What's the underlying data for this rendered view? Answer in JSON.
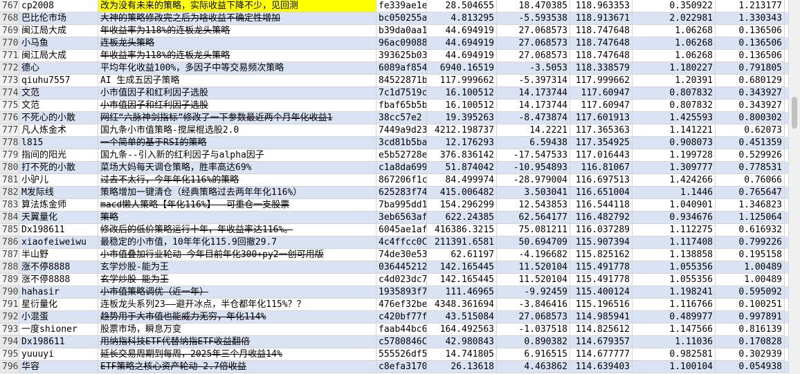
{
  "rows": [
    {
      "n": "767",
      "user": "cp2008",
      "name": "改为没有未来的策略，实际收益下降不少，见回测",
      "id": "fe339ae1e",
      "a": "28.504655",
      "b": "18.470385",
      "c": "118.963353",
      "d": "0.350922",
      "e": "1.213177",
      "strike": false,
      "hl": true
    },
    {
      "n": "768",
      "user": "巴比伦市场",
      "name": "大神的策略修改完之后为啥收益不确定性增加",
      "id": "bc050255a",
      "a": "4.813295",
      "b": "-5.593538",
      "c": "118.913671",
      "d": "2.022981",
      "e": "1.330343",
      "strike": true,
      "hl": false
    },
    {
      "n": "769",
      "user": "闽江局大成",
      "name": "年收益率为118%的连板龙头策略",
      "id": "b39da0aa1",
      "a": "44.694919",
      "b": "27.068573",
      "c": "118.747648",
      "d": "1.06268",
      "e": "0.136506",
      "strike": true,
      "hl": false
    },
    {
      "n": "770",
      "user": "小马鱼",
      "name": "连板龙头策略",
      "id": "96ac09088",
      "a": "44.694919",
      "b": "27.068573",
      "c": "118.747648",
      "d": "1.06268",
      "e": "0.136506",
      "strike": true,
      "hl": false
    },
    {
      "n": "771",
      "user": "闽江局大成",
      "name": "年收益率为118%的连板龙头策略",
      "id": "393625b03",
      "a": "44.694919",
      "b": "27.068573",
      "c": "118.747648",
      "d": "1.06268",
      "e": "0.136506",
      "strike": true,
      "hl": false
    },
    {
      "n": "772",
      "user": "德心",
      "name": "平均年化收益100%，多因子中等交易频次策略",
      "id": "6089af854",
      "a": "6940.16519",
      "b": "-3.5053",
      "c": "118.338579",
      "d": "1.180227",
      "e": "0.791805",
      "strike": false,
      "hl": false
    },
    {
      "n": "773",
      "user": "qiuhu7557",
      "name": "AI 生成五因子策略",
      "id": "84522871b",
      "a": "117.999662",
      "b": "-5.397314",
      "c": "117.999662",
      "d": "1.20391",
      "e": "0.680129",
      "strike": false,
      "hl": false
    },
    {
      "n": "774",
      "user": "文范",
      "name": "小市值因子和红利因子选股",
      "id": "7c1d7519c",
      "a": "16.100512",
      "b": "14.173744",
      "c": "117.60947",
      "d": "0.807832",
      "e": "0.343927",
      "strike": false,
      "hl": false
    },
    {
      "n": "775",
      "user": "文范",
      "name": "小市值因子和红利因子选股",
      "id": "fbaf65b5b",
      "a": "16.100512",
      "b": "14.173744",
      "c": "117.60947",
      "d": "0.807832",
      "e": "0.343927",
      "strike": true,
      "hl": false
    },
    {
      "n": "776",
      "user": "不死心的小散",
      "name": "网红“六脉神剑指标”修改了一下参数最近两个月年化收益1",
      "id": "38cc57e2",
      "a": "19.395263",
      "b": "-8.473874",
      "c": "117.601913",
      "d": "1.425593",
      "e": "0.800302",
      "strike": true,
      "hl": false
    },
    {
      "n": "777",
      "user": "凡人炼金术",
      "name": "国九条小市值策略-搅屎棍选股2.0",
      "id": "7449a9d23",
      "a": "4212.198737",
      "b": "14.2221",
      "c": "117.365363",
      "d": "1.141221",
      "e": "0.62073",
      "strike": false,
      "hl": false
    },
    {
      "n": "778",
      "user": "l815",
      "name": "一个简单的基于RSI的策略",
      "id": "3cd81b5ba",
      "a": "12.176293",
      "b": "6.59438",
      "c": "117.354925",
      "d": "0.908073",
      "e": "0.451359",
      "strike": true,
      "hl": false
    },
    {
      "n": "779",
      "user": "指间的阳光",
      "name": "国九条--引入新的红利因子与alpha因子",
      "id": "e5b52728e",
      "a": "376.836142",
      "b": "-17.547533",
      "c": "117.016443",
      "d": "1.199728",
      "e": "0.529926",
      "strike": false,
      "hl": false
    },
    {
      "n": "780",
      "user": "打不死的小散",
      "name": "菜场大妈每天调仓策略，胜率高达69%",
      "id": "c1a8da699",
      "a": "51.874042",
      "b": "-10.954893",
      "c": "116.81067",
      "d": "1.309777",
      "e": "0.778531",
      "strike": false,
      "hl": false
    },
    {
      "n": "781",
      "user": "小驴儿",
      "name": "过去不太行，今年年化116%的策略",
      "id": "867206f1c",
      "a": "84.499974",
      "b": "-28.979004",
      "c": "116.697513",
      "d": "1.424266",
      "e": "0.76066",
      "strike": true,
      "hl": false
    },
    {
      "n": "782",
      "user": "M发际线",
      "name": "策略增加一键清仓（经典策略过去两年年化116%）",
      "id": "625283f74",
      "a": "415.006482",
      "b": "3.503041",
      "c": "116.651004",
      "d": "1.1446",
      "e": "0.765647",
      "strike": false,
      "hl": false
    },
    {
      "n": "783",
      "user": "算法炼金师",
      "name": "macd懒人策略【年化116%】——可重仓一支股票",
      "id": "7ba995dd1",
      "a": "154.296299",
      "b": "12.543853",
      "c": "116.544118",
      "d": "1.040901",
      "e": "1.346823",
      "strike": true,
      "hl": false
    },
    {
      "n": "784",
      "user": "天翼量化",
      "name": "策略",
      "id": "3eb6563af",
      "a": "622.24385",
      "b": "62.564177",
      "c": "116.482792",
      "d": "0.934676",
      "e": "1.125064",
      "strike": true,
      "hl": false
    },
    {
      "n": "785",
      "user": "Dx198611",
      "name": "修改后的低价策略运行十年，年收益率达116%。",
      "id": "6045ae1af",
      "a": "416386.3215",
      "b": "75.081211",
      "c": "116.037289",
      "d": "1.112275",
      "e": "0.616932",
      "strike": true,
      "hl": false
    },
    {
      "n": "786",
      "user": "xiaofeiweiwu",
      "name": "最稳定的小市值，10年年化115.9回撤29.7",
      "id": "4c4ffcc0C",
      "a": "211391.6581",
      "b": "50.694709",
      "c": "115.907394",
      "d": "1.117408",
      "e": "0.799226",
      "strike": false,
      "hl": false
    },
    {
      "n": "787",
      "user": "半山野",
      "name": "小市值叠加行业轮动 今年目前年化300+py2一创可用版",
      "id": "74de30e53",
      "a": "62.61197",
      "b": "-4.196682",
      "c": "115.825162",
      "d": "1.138858",
      "e": "0.195158",
      "strike": true,
      "hl": false
    },
    {
      "n": "788",
      "user": "涨不停8888",
      "name": "玄学炒股-能为王",
      "id": "036445212",
      "a": "142.165445",
      "b": "11.520104",
      "c": "115.491778",
      "d": "1.055356",
      "e": "1.00489",
      "strike": false,
      "hl": false
    },
    {
      "n": "789",
      "user": "涨不停8888",
      "name": "玄学炒股-能为王",
      "id": "c4d023dc7",
      "a": "142.165445",
      "b": "11.520104",
      "c": "115.491778",
      "d": "1.055356",
      "e": "1.00489",
      "strike": true,
      "hl": false
    },
    {
      "n": "790",
      "user": "hahasir",
      "name": "小市值策略调优（近一年）",
      "id": "1935893f7",
      "a": "111.46965",
      "b": "-9.92459",
      "c": "115.400124",
      "d": "1.198241",
      "e": "0.595092",
      "strike": true,
      "hl": false
    },
    {
      "n": "791",
      "user": "星衍量化",
      "name": "连板龙头系列23——避开冰点，半仓都年化115%？？",
      "id": "476ef32be",
      "a": "4348.361694",
      "b": "-3.846416",
      "c": "115.196516",
      "d": "1.116766",
      "e": "0.100251",
      "strike": false,
      "hl": false
    },
    {
      "n": "792",
      "user": "小混蛋",
      "name": "趋势用于大市值也能威力无穷，年化114%",
      "id": "c420bf77f",
      "a": "43.515084",
      "b": "27.068573",
      "c": "114.985941",
      "d": "0.489977",
      "e": "0.997891",
      "strike": true,
      "hl": false
    },
    {
      "n": "793",
      "user": "一度shioner",
      "name": "股票市场，瞬息万变",
      "id": "faab44bc6",
      "a": "164.492563",
      "b": "-1.037518",
      "c": "114.825612",
      "d": "1.147566",
      "e": "0.816139",
      "strike": false,
      "hl": false
    },
    {
      "n": "794",
      "user": "Dx198611",
      "name": "用纳指科技ETF代替纳指ETF收益翻倍",
      "id": "c5780846C",
      "a": "42.980843",
      "b": "0.890382",
      "c": "114.679357",
      "d": "1.11036",
      "e": "0.170828",
      "strike": true,
      "hl": false
    },
    {
      "n": "795",
      "user": "yuuuyi",
      "name": "延长交易周期到每周，2025年三个月收益14%",
      "id": "555526df5",
      "a": "14.741805",
      "b": "6.916515",
      "c": "114.677777",
      "d": "0.982581",
      "e": "0.302939",
      "strike": true,
      "hl": false
    },
    {
      "n": "796",
      "user": "华容",
      "name": "ETF策略之核心资产轮动-2.7倍收益",
      "id": "c8efa3170",
      "a": "26.13618",
      "b": "4.463862",
      "c": "114.639403",
      "d": "1.100104",
      "e": "0.054938",
      "strike": true,
      "hl": false
    }
  ]
}
